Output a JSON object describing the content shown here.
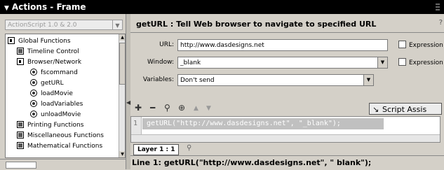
{
  "panel": {
    "title": "Actions - Frame"
  },
  "left": {
    "version_select": "ActionScript 1.0 & 2.0",
    "tree": [
      {
        "label": "Global Functions",
        "icon": "folder-icon"
      },
      {
        "label": "Timeline Control",
        "icon": "book-icon"
      },
      {
        "label": "Browser/Network",
        "icon": "folder-icon"
      },
      {
        "label": "fscommand",
        "icon": "function-icon"
      },
      {
        "label": "getURL",
        "icon": "function-icon"
      },
      {
        "label": "loadMovie",
        "icon": "function-icon"
      },
      {
        "label": "loadVariables",
        "icon": "function-icon"
      },
      {
        "label": "unloadMovie",
        "icon": "function-icon"
      },
      {
        "label": "Printing Functions",
        "icon": "book-icon"
      },
      {
        "label": "Miscellaneous Functions",
        "icon": "book-icon"
      },
      {
        "label": "Mathematical Functions",
        "icon": "book-icon"
      }
    ]
  },
  "main": {
    "header": "getURL : Tell Web browser to navigate to specified URL",
    "params": {
      "url_label": "URL:",
      "url_value": "http://www.dasdesigns.net",
      "window_label": "Window:",
      "window_value": "_blank",
      "variables_label": "Variables:",
      "variables_value": "Don't send",
      "expression_label": "Expression"
    },
    "script_assist": "Script Assis",
    "code": {
      "line_number": "1",
      "text": "getURL(\"http://www.dasdesigns.net\", \"_blank\");"
    },
    "layer_tab": "Layer 1 : 1",
    "status": "Line 1: getURL(\"http://www.dasdesigns.net\", \" blank\");"
  }
}
